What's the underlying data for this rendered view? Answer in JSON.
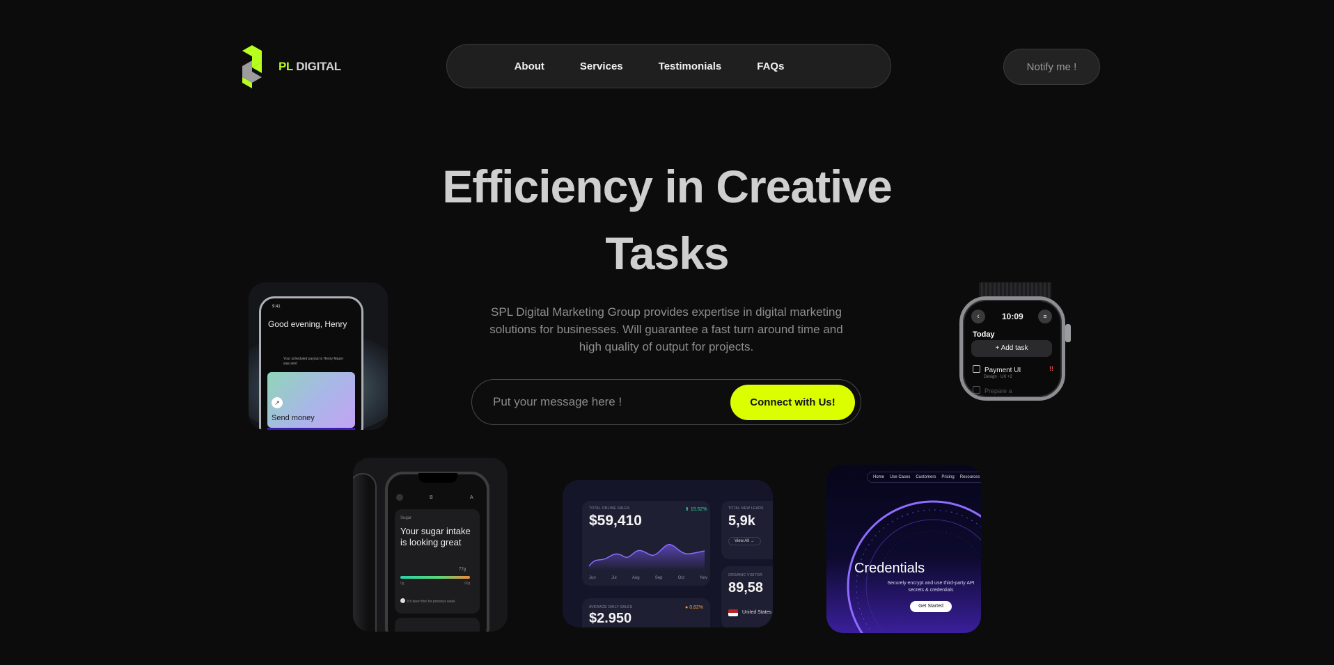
{
  "brand": {
    "logo_accent": "PL",
    "logo_rest": " DIGITAL",
    "accent_color": "#b6ff1e"
  },
  "nav": {
    "items": [
      {
        "label": "About"
      },
      {
        "label": "Services"
      },
      {
        "label": "Testimonials"
      },
      {
        "label": "FAQs"
      }
    ]
  },
  "header": {
    "notify_label": "Notify me !"
  },
  "hero": {
    "title_line1": "Efficiency in Creative",
    "title_line2": "Tasks",
    "description": "SPL Digital Marketing Group provides expertise in digital marketing solutions for businesses. Will guarantee a fast turn around time and high quality of output for projects.",
    "input_placeholder": "Put your message here !",
    "cta_label": "Connect with Us!",
    "cta_color": "#dcff00"
  },
  "cards": {
    "phone": {
      "status_time": "9:41",
      "greeting": "Good evening, Henry",
      "note": "Your scheduled payout to Henry Mazer was sent",
      "send_label": "Send money"
    },
    "watch": {
      "time": "10:09",
      "section": "Today",
      "add_task": "+ Add task",
      "task1": "Payment UI",
      "task1_meta": "Design · UX +2",
      "task1_flag": "!!",
      "task2": "Prepare a"
    },
    "health": {
      "tab_b": "B",
      "tab_a": "A",
      "tag": "Sugar",
      "headline": "Your sugar intake is looking great",
      "value": "77g",
      "min": "0g",
      "max": "90g",
      "tip": "It's been fine for previous week"
    },
    "dashboard": {
      "total_sales_label": "TOTAL ONLINE SALES",
      "total_sales": "$59,410",
      "total_sales_change": "15.52%",
      "visitors_label": "TOTAL NEW LEADS",
      "visitors": "5,9k",
      "view_all": "View All →",
      "organic_label": "ORGANIC VISITOR",
      "organic": "89,58",
      "country": "United States",
      "avg_label": "AVERAGE DAILY SALES",
      "avg_sales": "$2.950",
      "avg_change": "0,82%",
      "months": [
        "Jun",
        "Jul",
        "Aug",
        "Sep",
        "Oct",
        "Nov"
      ]
    },
    "credentials": {
      "nav": [
        "Home",
        "Use Cases",
        "Customers",
        "Pricing",
        "Resources"
      ],
      "title": "Credentials",
      "subtitle": "Securely encrypt and use third-party API secrets & credentials",
      "button": "Get Started"
    }
  }
}
